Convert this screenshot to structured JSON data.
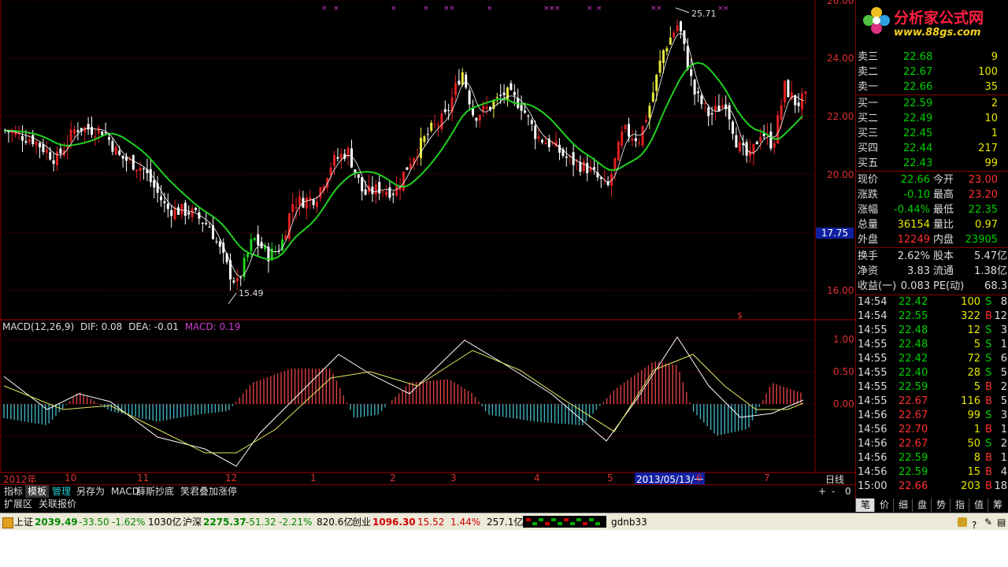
{
  "main_chart": {
    "y_labels": [
      "26.00",
      "24.00",
      "22.00",
      "20.00",
      "16.00"
    ],
    "price_tag": "17.75",
    "high_mark": "25.71",
    "low_mark": "15.49"
  },
  "macd": {
    "title": "MACD(12,26,9)",
    "dif": "DIF: 0.08",
    "dea": "DEA: -0.01",
    "macd_val": "MACD: 0.19",
    "y_labels": [
      "1.00",
      "0.50",
      "0.00"
    ]
  },
  "x_axis": {
    "labels": [
      "2012年",
      "10",
      "11",
      "12",
      "1",
      "2",
      "3",
      "4",
      "5",
      "2013/05/13/一",
      "6",
      "7"
    ],
    "period": "日线"
  },
  "tabs": [
    "指标",
    "模板",
    "管理",
    "另存为",
    "MACD",
    "薛斯抄底",
    "笑君叠加涨停"
  ],
  "tabs_row2": [
    "扩展区",
    "关联报价"
  ],
  "zoom": [
    "+",
    "-",
    "0"
  ],
  "right_panel": {
    "logo_text": "分析家公式网",
    "logo_url": "www.88gs.com",
    "sell": [
      {
        "label": "卖三",
        "price": "22.68",
        "vol": "9"
      },
      {
        "label": "卖二",
        "price": "22.67",
        "vol": "100"
      },
      {
        "label": "卖一",
        "price": "22.66",
        "vol": "35"
      }
    ],
    "buy": [
      {
        "label": "买一",
        "price": "22.59",
        "vol": "2"
      },
      {
        "label": "买二",
        "price": "22.49",
        "vol": "10"
      },
      {
        "label": "买三",
        "price": "22.45",
        "vol": "1"
      },
      {
        "label": "买四",
        "price": "22.44",
        "vol": "217"
      },
      {
        "label": "买五",
        "price": "22.43",
        "vol": "99"
      }
    ],
    "quote": [
      {
        "l1": "现价",
        "v1": "22.66",
        "l2": "今开",
        "v2": "23.00"
      },
      {
        "l1": "涨跌",
        "v1": "-0.10",
        "l2": "最高",
        "v2": "23.20"
      },
      {
        "l1": "涨幅",
        "v1": "-0.44%",
        "l2": "最低",
        "v2": "22.35"
      },
      {
        "l1": "总量",
        "v1": "36154",
        "l2": "量比",
        "v2": "0.97"
      },
      {
        "l1": "外盘",
        "v1": "12249",
        "l2": "内盘",
        "v2": "23905"
      }
    ],
    "info": [
      {
        "l1": "换手",
        "v1": "2.62%",
        "l2": "股本",
        "v2": "5.47亿"
      },
      {
        "l1": "净资",
        "v1": "3.83",
        "l2": "流通",
        "v2": "1.38亿"
      },
      {
        "l1": "收益(一)",
        "v1": "0.083",
        "l2": "PE(动)",
        "v2": "68.3"
      }
    ],
    "ticks": [
      {
        "t": "14:54",
        "p": "22.42",
        "v": "100",
        "s": "S",
        "n": "8"
      },
      {
        "t": "14:54",
        "p": "22.55",
        "v": "322",
        "s": "B",
        "n": "12"
      },
      {
        "t": "14:55",
        "p": "22.48",
        "v": "12",
        "s": "S",
        "n": "3"
      },
      {
        "t": "14:55",
        "p": "22.48",
        "v": "5",
        "s": "S",
        "n": "1"
      },
      {
        "t": "14:55",
        "p": "22.42",
        "v": "72",
        "s": "S",
        "n": "6"
      },
      {
        "t": "14:55",
        "p": "22.40",
        "v": "28",
        "s": "S",
        "n": "5"
      },
      {
        "t": "14:55",
        "p": "22.59",
        "v": "5",
        "s": "B",
        "n": "2"
      },
      {
        "t": "14:55",
        "p": "22.67",
        "v": "116",
        "s": "B",
        "n": "5"
      },
      {
        "t": "14:56",
        "p": "22.67",
        "v": "99",
        "s": "S",
        "n": "3"
      },
      {
        "t": "14:56",
        "p": "22.70",
        "v": "1",
        "s": "B",
        "n": "1"
      },
      {
        "t": "14:56",
        "p": "22.67",
        "v": "50",
        "s": "S",
        "n": "2"
      },
      {
        "t": "14:56",
        "p": "22.59",
        "v": "8",
        "s": "B",
        "n": "1"
      },
      {
        "t": "14:56",
        "p": "22.59",
        "v": "15",
        "s": "B",
        "n": "4"
      },
      {
        "t": "15:00",
        "p": "22.66",
        "v": "203",
        "s": "B",
        "n": "18"
      }
    ],
    "tabs": [
      "笔",
      "价",
      "细",
      "盘",
      "势",
      "指",
      "值",
      "筹"
    ]
  },
  "status_bar": {
    "sh_label": "上证",
    "sh_val": "2039.49",
    "sh_chg": "-33.50",
    "sh_pct": "-1.62%",
    "sh_amt": "1030亿",
    "hs_label": "沪深",
    "hs_val": "2275.37",
    "hs_chg": "-51.32",
    "hs_pct": "-2.21%",
    "hs_amt": "820.6亿",
    "cy_label": "创业",
    "cy_val": "1096.30",
    "cy_chg": "15.52",
    "cy_pct": "1.44%",
    "cy_amt": "257.1亿",
    "user": "gdnb33"
  },
  "colors": {
    "up": "#e02020",
    "down": "#ffffff",
    "ma": "#20d020",
    "yellow": "#e8e840",
    "macd_pos": "#e04040",
    "macd_neg": "#40b0c0"
  }
}
